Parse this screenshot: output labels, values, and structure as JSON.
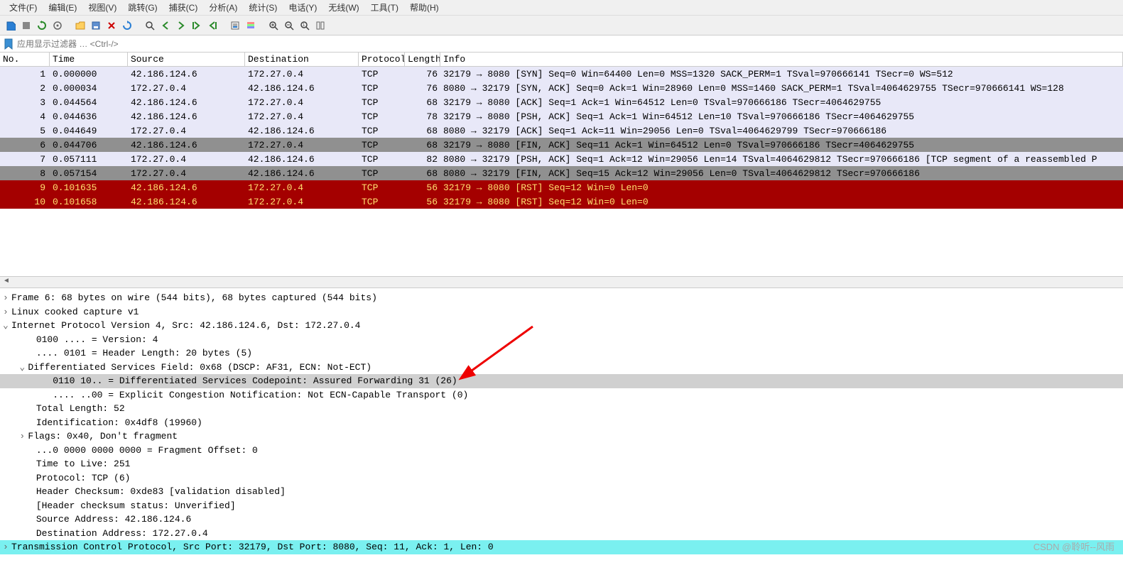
{
  "menu": {
    "items": [
      "文件(F)",
      "编辑(E)",
      "视图(V)",
      "跳转(G)",
      "捕获(C)",
      "分析(A)",
      "统计(S)",
      "电话(Y)",
      "无线(W)",
      "工具(T)",
      "帮助(H)"
    ]
  },
  "filter": {
    "placeholder": "应用显示过滤器 … <Ctrl-/>"
  },
  "columns": {
    "no": "No.",
    "time": "Time",
    "src": "Source",
    "dst": "Destination",
    "proto": "Protocol",
    "len": "Length",
    "info": "Info"
  },
  "packets": [
    {
      "no": "1",
      "time": "0.000000",
      "src": "42.186.124.6",
      "dst": "172.27.0.4",
      "proto": "TCP",
      "len": "76",
      "info": "32179 → 8080 [SYN] Seq=0 Win=64400 Len=0 MSS=1320 SACK_PERM=1 TSval=970666141 TSecr=0 WS=512",
      "bg": "#e8e8f8",
      "fg": "#000"
    },
    {
      "no": "2",
      "time": "0.000034",
      "src": "172.27.0.4",
      "dst": "42.186.124.6",
      "proto": "TCP",
      "len": "76",
      "info": "8080 → 32179 [SYN, ACK] Seq=0 Ack=1 Win=28960 Len=0 MSS=1460 SACK_PERM=1 TSval=4064629755 TSecr=970666141 WS=128",
      "bg": "#e8e8f8",
      "fg": "#000"
    },
    {
      "no": "3",
      "time": "0.044564",
      "src": "42.186.124.6",
      "dst": "172.27.0.4",
      "proto": "TCP",
      "len": "68",
      "info": "32179 → 8080 [ACK] Seq=1 Ack=1 Win=64512 Len=0 TSval=970666186 TSecr=4064629755",
      "bg": "#e8e8f8",
      "fg": "#000"
    },
    {
      "no": "4",
      "time": "0.044636",
      "src": "42.186.124.6",
      "dst": "172.27.0.4",
      "proto": "TCP",
      "len": "78",
      "info": "32179 → 8080 [PSH, ACK] Seq=1 Ack=1 Win=64512 Len=10 TSval=970666186 TSecr=4064629755",
      "bg": "#e8e8f8",
      "fg": "#000"
    },
    {
      "no": "5",
      "time": "0.044649",
      "src": "172.27.0.4",
      "dst": "42.186.124.6",
      "proto": "TCP",
      "len": "68",
      "info": "8080 → 32179 [ACK] Seq=1 Ack=11 Win=29056 Len=0 TSval=4064629799 TSecr=970666186",
      "bg": "#e8e8f8",
      "fg": "#000"
    },
    {
      "no": "6",
      "time": "0.044706",
      "src": "42.186.124.6",
      "dst": "172.27.0.4",
      "proto": "TCP",
      "len": "68",
      "info": "32179 → 8080 [FIN, ACK] Seq=11 Ack=1 Win=64512 Len=0 TSval=970666186 TSecr=4064629755",
      "bg": "#909090",
      "fg": "#000"
    },
    {
      "no": "7",
      "time": "0.057111",
      "src": "172.27.0.4",
      "dst": "42.186.124.6",
      "proto": "TCP",
      "len": "82",
      "info": "8080 → 32179 [PSH, ACK] Seq=1 Ack=12 Win=29056 Len=14 TSval=4064629812 TSecr=970666186 [TCP segment of a reassembled P",
      "bg": "#e8e8f8",
      "fg": "#000"
    },
    {
      "no": "8",
      "time": "0.057154",
      "src": "172.27.0.4",
      "dst": "42.186.124.6",
      "proto": "TCP",
      "len": "68",
      "info": "8080 → 32179 [FIN, ACK] Seq=15 Ack=12 Win=29056 Len=0 TSval=4064629812 TSecr=970666186",
      "bg": "#909090",
      "fg": "#000"
    },
    {
      "no": "9",
      "time": "0.101635",
      "src": "42.186.124.6",
      "dst": "172.27.0.4",
      "proto": "TCP",
      "len": "56",
      "info": "32179 → 8080 [RST] Seq=12 Win=0 Len=0",
      "bg": "#a40000",
      "fg": "#ffe070"
    },
    {
      "no": "10",
      "time": "0.101658",
      "src": "42.186.124.6",
      "dst": "172.27.0.4",
      "proto": "TCP",
      "len": "56",
      "info": "32179 → 8080 [RST] Seq=12 Win=0 Len=0",
      "bg": "#a40000",
      "fg": "#ffe070"
    }
  ],
  "details": {
    "frame": "Frame 6: 68 bytes on wire (544 bits), 68 bytes captured (544 bits)",
    "linux": "Linux cooked capture v1",
    "ipv4": "Internet Protocol Version 4, Src: 42.186.124.6, Dst: 172.27.0.4",
    "version": "0100 .... = Version: 4",
    "hlen": ".... 0101 = Header Length: 20 bytes (5)",
    "dsfield": "Differentiated Services Field: 0x68 (DSCP: AF31, ECN: Not-ECT)",
    "dscp": "0110 10.. = Differentiated Services Codepoint: Assured Forwarding 31 (26)",
    "ecn": ".... ..00 = Explicit Congestion Notification: Not ECN-Capable Transport (0)",
    "tot_len": "Total Length: 52",
    "ident": "Identification: 0x4df8 (19960)",
    "flags": "Flags: 0x40, Don't fragment",
    "frag": "...0 0000 0000 0000 = Fragment Offset: 0",
    "ttl": "Time to Live: 251",
    "proto": "Protocol: TCP (6)",
    "checksum": "Header Checksum: 0xde83 [validation disabled]",
    "checksum_status": "[Header checksum status: Unverified]",
    "src_addr": "Source Address: 42.186.124.6",
    "dst_addr": "Destination Address: 172.27.0.4",
    "tcp": "Transmission Control Protocol, Src Port: 32179, Dst Port: 8080, Seq: 11, Ack: 1, Len: 0"
  },
  "watermark": "CSDN @聆听--风雨"
}
